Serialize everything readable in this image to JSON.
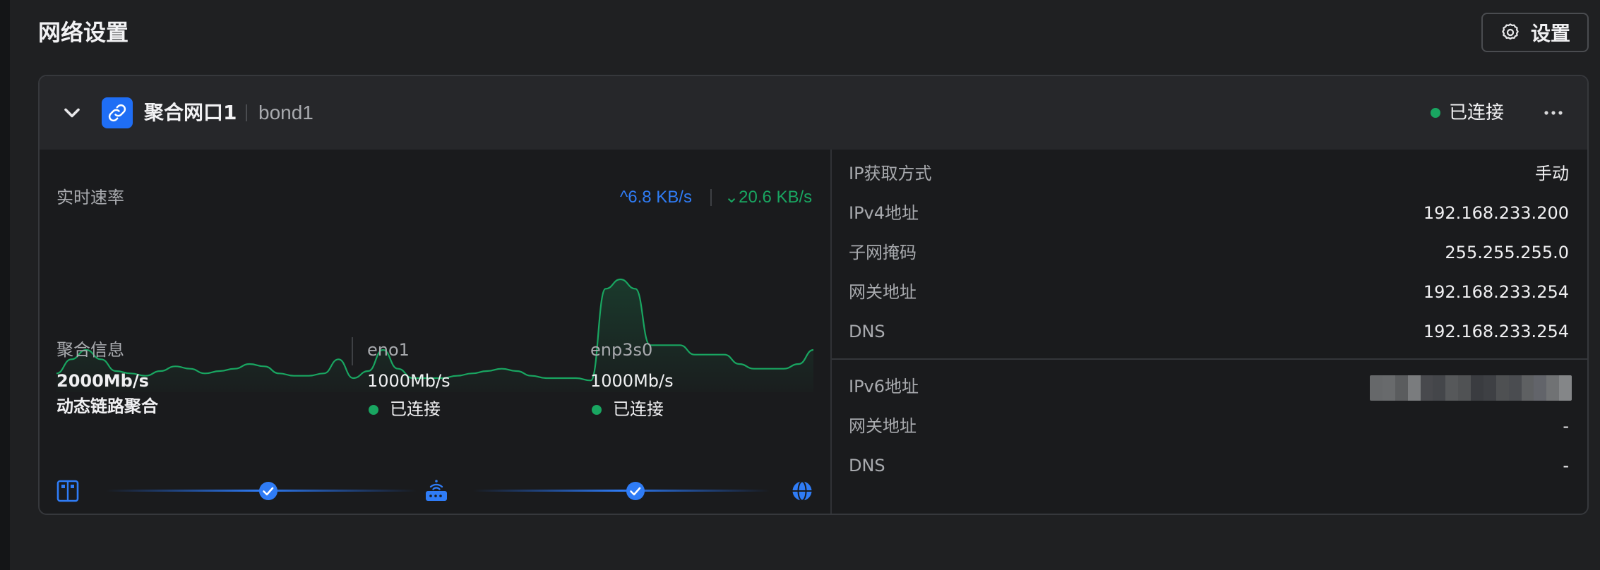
{
  "page": {
    "title": "网络设置",
    "settings_label": "设置"
  },
  "bond": {
    "name": "聚合网口1",
    "id": "bond1",
    "status": "已连接"
  },
  "rate": {
    "label": "实时速率",
    "up": "^6.8 KB/s",
    "down": "⌄20.6 KB/s"
  },
  "aggregate": {
    "title": "聚合信息",
    "speed": "2000Mb/s",
    "mode": "动态链路聚合"
  },
  "ports": [
    {
      "name": "eno1",
      "speed": "1000Mb/s",
      "status": "已连接"
    },
    {
      "name": "enp3s0",
      "speed": "1000Mb/s",
      "status": "已连接"
    }
  ],
  "ipv4": [
    {
      "label": "IP获取方式",
      "value": "手动"
    },
    {
      "label": "IPv4地址",
      "value": "192.168.233.200"
    },
    {
      "label": "子网掩码",
      "value": "255.255.255.0"
    },
    {
      "label": "网关地址",
      "value": "192.168.233.254"
    },
    {
      "label": "DNS",
      "value": "192.168.233.254"
    }
  ],
  "ipv6": [
    {
      "label": "IPv6地址",
      "value": ""
    },
    {
      "label": "网关地址",
      "value": "-"
    },
    {
      "label": "DNS",
      "value": "-"
    }
  ],
  "colors": {
    "accent": "#1f6ef5",
    "connected": "#19a661",
    "upload": "#2f7cf6",
    "download": "#19a661"
  },
  "icons": {
    "settings": "gear-icon",
    "collapse": "chevron-down-icon",
    "bond": "link-icon",
    "more": "ellipsis-icon",
    "nas": "server-icon",
    "router": "router-icon",
    "internet": "globe-icon",
    "check": "check-circle-icon"
  },
  "chart_data": {
    "type": "area",
    "title": "实时速率",
    "series": [
      {
        "values": [
          8,
          14,
          18,
          14,
          9,
          8,
          7,
          9,
          11,
          10,
          8,
          9,
          10,
          12,
          11,
          8,
          7,
          7,
          8,
          14,
          6,
          9,
          18,
          10,
          6,
          6,
          6,
          7,
          8,
          9,
          10,
          9,
          7,
          6,
          6,
          6,
          5,
          44,
          48,
          44,
          20,
          20,
          20,
          16,
          16,
          16,
          12,
          10,
          10,
          10,
          12,
          18
        ]
      }
    ]
  }
}
